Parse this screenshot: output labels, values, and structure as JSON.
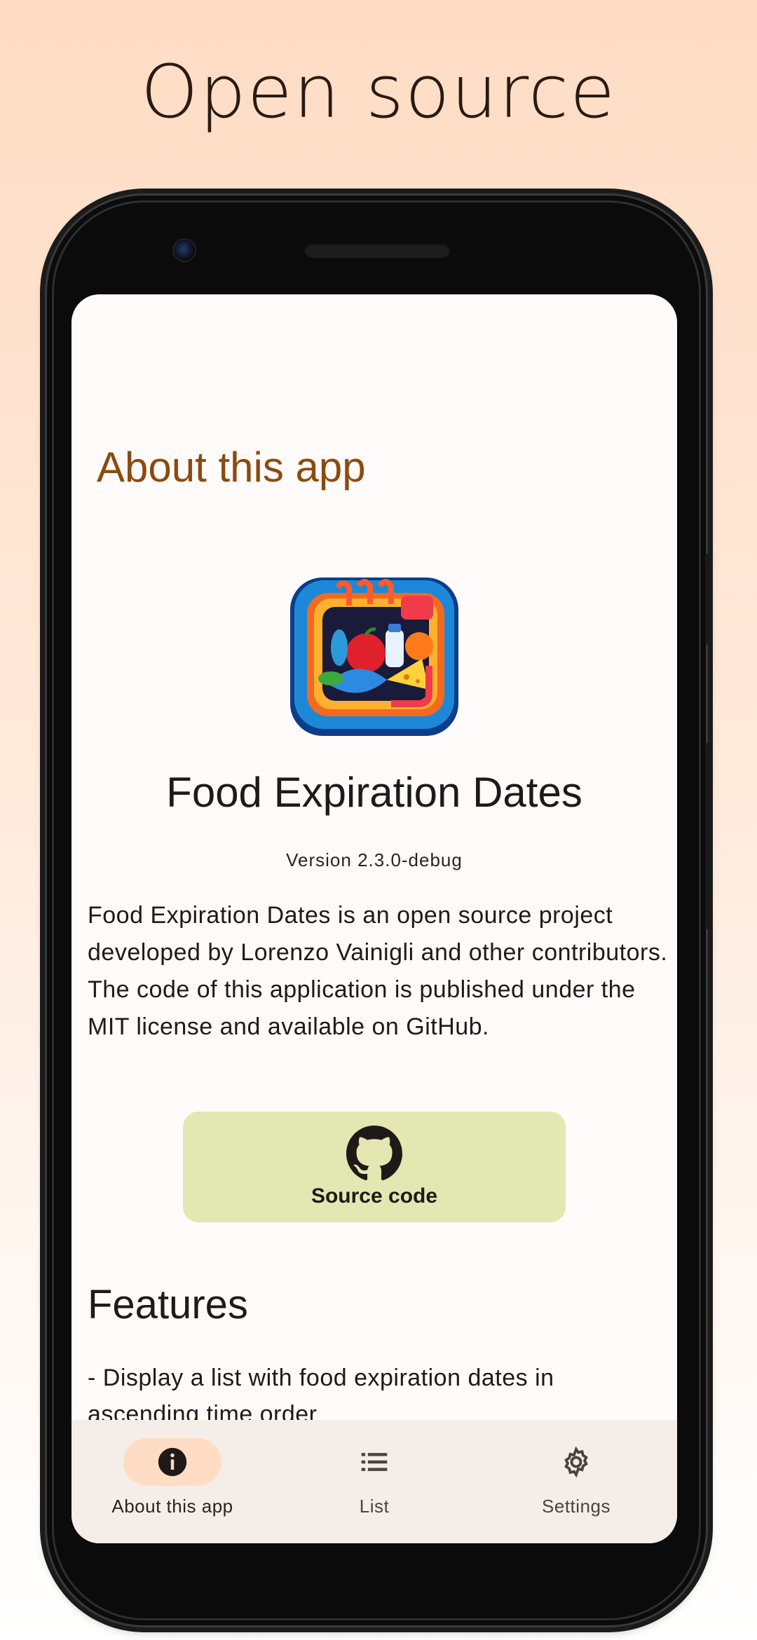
{
  "headline": "Open source",
  "page": {
    "title": "About this app",
    "app_name": "Food Expiration Dates",
    "version": "Version 2.3.0-debug",
    "description_lines": [
      "Food Expiration Dates is an open source project developed by Lorenzo Vainigli and other contributors.",
      "The code of this application is published under the MIT license and available on GitHub."
    ],
    "source_button_label": "Source code",
    "features_title": "Features",
    "features": [
      "- Display a list with food expiration dates in ascending time order"
    ]
  },
  "nav": {
    "items": [
      {
        "label": "About this app",
        "icon": "info-icon",
        "active": true
      },
      {
        "label": "List",
        "icon": "list-icon",
        "active": false
      },
      {
        "label": "Settings",
        "icon": "gear-icon",
        "active": false
      }
    ]
  },
  "colors": {
    "accent_title": "#8b4a0f",
    "source_button_bg": "#e3e7b1",
    "nav_active_pill": "#ffdcc4",
    "nav_bg": "#f5ede7"
  }
}
